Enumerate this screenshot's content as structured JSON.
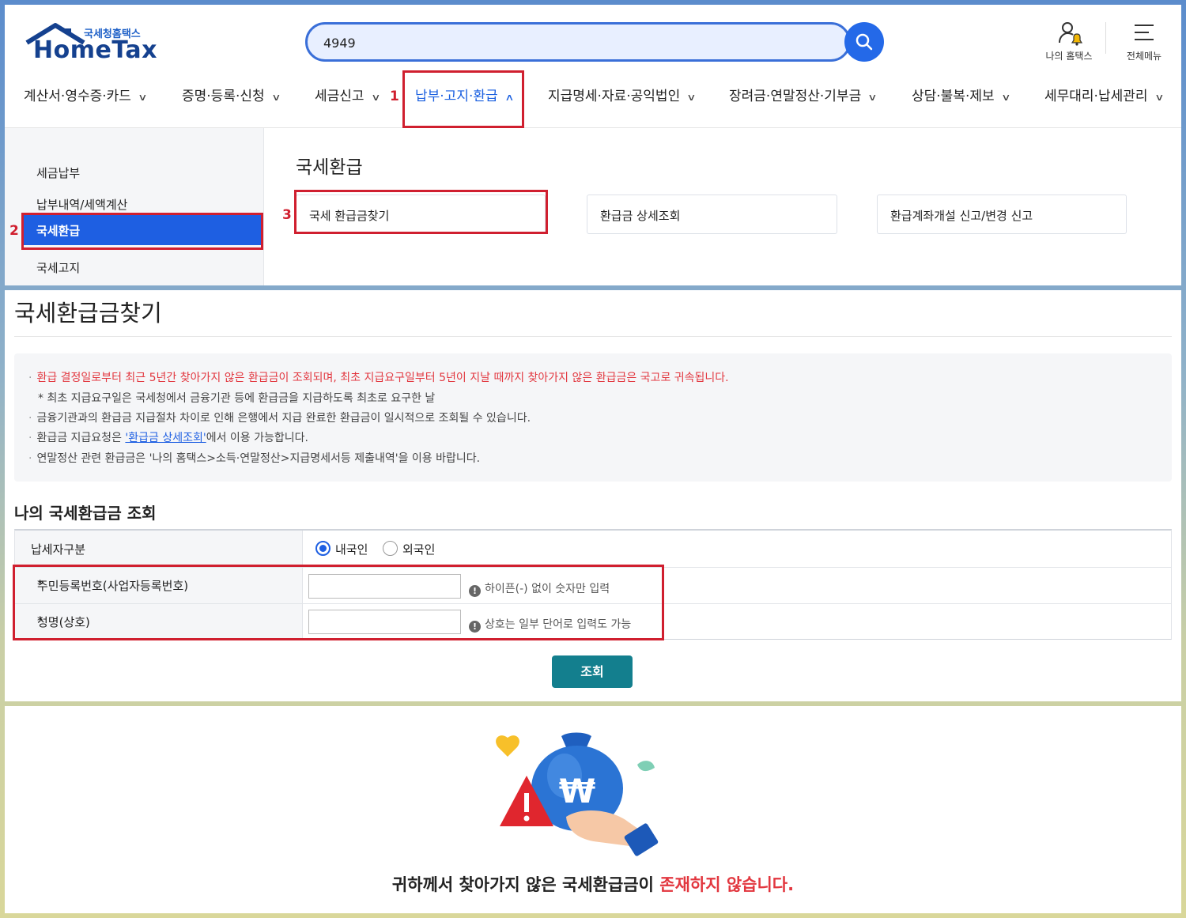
{
  "header": {
    "logo_sub": "국세청홈택스",
    "logo_main": "HomeTax",
    "search_value": "4949",
    "my_hometax": "나의 홈택스",
    "all_menu": "전체메뉴"
  },
  "gnb": [
    {
      "label": "계산서·영수증·카드"
    },
    {
      "label": "증명·등록·신청"
    },
    {
      "label": "세금신고"
    },
    {
      "label": "납부·고지·환급"
    },
    {
      "label": "지급명세·자료·공익법인"
    },
    {
      "label": "장려금·연말정산·기부금"
    },
    {
      "label": "상담·불복·제보"
    },
    {
      "label": "세무대리·납세관리"
    }
  ],
  "steps": [
    "1",
    "2",
    "3"
  ],
  "lnb": {
    "items": [
      "세금납부",
      "납부내역/세액계산",
      "국세환급",
      "국세고지"
    ]
  },
  "submenu": {
    "title": "국세환급",
    "cards": [
      "국세 환급금찾기",
      "환급금 상세조회",
      "환급계좌개설 신고/변경 신고"
    ]
  },
  "page": {
    "title": "국세환급금찾기",
    "notices": [
      "환급 결정일로부터 최근 5년간 찾아가지 않은 환급금이 조회되며, 최초 지급요구일부터 5년이 지날 때까지 찾아가지 않은 환급금은 국고로 귀속됩니다.",
      "* 최초 지급요구일은 국세청에서 금융기관 등에 환급금을 지급하도록 최초로 요구한 날",
      "금융기관과의 환급금 지급절차 차이로 인해 은행에서 지급 완료한 환급금이 일시적으로 조회될 수 있습니다.",
      "환급금 지급요청은",
      "'환급금 상세조회'",
      "에서 이용 가능합니다.",
      "연말정산 관련 환급금은 '나의 홈택스>소득·연말정산>지급명세서등 제출내역'을 이용 바랍니다."
    ],
    "section_title": "나의 국세환급금 조회",
    "form": {
      "taxpayer_type_label": "납세자구분",
      "radio_domestic": "내국인",
      "radio_foreign": "외국인",
      "selected": "내국인",
      "id_label": "주민등록번호(사업자등록번호)",
      "id_value": "",
      "id_hint": "하이픈(-) 없이 숫자만 입력",
      "name_label": "성명(상호)",
      "name_value": "",
      "name_hint": "상호는 일부 단어로 입력도 가능",
      "required_mark": "*",
      "hint_icon": "!"
    },
    "query_button": "조회"
  },
  "result": {
    "prefix": "귀하께서 찾아가지 않은 국세환급금이 ",
    "highlight": "존재하지 않습니다."
  },
  "colors": {
    "accent_blue": "#1e5fe2",
    "highlight_red": "#d01f2f",
    "button_teal": "#137f8e"
  },
  "icons": [
    "home-logo-icon",
    "search-icon",
    "user-bell-icon",
    "hamburger-icon",
    "chevron-down-icon",
    "chevron-up-icon",
    "info-icon",
    "money-bag-hand-illustration"
  ]
}
